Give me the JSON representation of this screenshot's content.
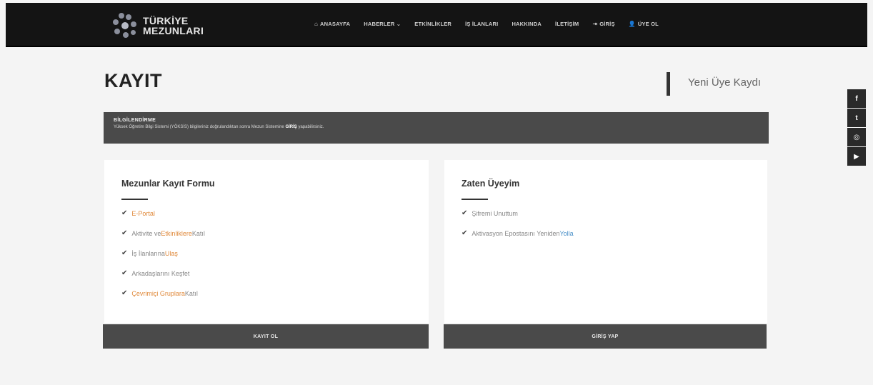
{
  "brand": {
    "line1": "TÜRKİYE",
    "line2": "MEZUNLARI"
  },
  "nav": {
    "items": [
      {
        "icon": "home-icon",
        "glyph": "⌂",
        "label": "ANASAYFA"
      },
      {
        "icon": "",
        "glyph": "",
        "label": "HABERLER ⌄"
      },
      {
        "icon": "",
        "glyph": "",
        "label": "ETKİNLİKLER"
      },
      {
        "icon": "",
        "glyph": "",
        "label": "İŞ İLANLARI"
      },
      {
        "icon": "",
        "glyph": "",
        "label": "HAKKINDA"
      },
      {
        "icon": "",
        "glyph": "",
        "label": "İLETİŞİM"
      },
      {
        "icon": "login-icon",
        "glyph": "⇥",
        "label": "GİRİŞ"
      },
      {
        "icon": "user-icon",
        "glyph": "👤",
        "label": "ÜYE OL"
      }
    ]
  },
  "page": {
    "title": "KAYIT",
    "subtitle": "Yeni Üye Kaydı"
  },
  "info": {
    "title": "BİLGİLENDİRME",
    "text_before": "Yüksek Öğretim Bilgi Sistemi (YÖKSİS) bilgileriniz doğrulandıktan sonra Mezun Sistemine ",
    "text_bold": "GİRİŞ",
    "text_after": " yapabilirsiniz."
  },
  "register_card": {
    "title": "Mezunlar Kayıt Formu",
    "items": [
      {
        "pre": "",
        "hl": "E-Portal",
        "post": ""
      },
      {
        "pre": "Aktivite ve ",
        "hl": "Etkinliklere",
        "post": " Katıl"
      },
      {
        "pre": "İş İlanlarına ",
        "hl": "Ulaş",
        "post": ""
      },
      {
        "pre": "Arkadaşlarını Keşfet",
        "hl": "",
        "post": ""
      },
      {
        "pre": "",
        "hl": "Çevrimiçi Gruplara",
        "post": " Katıl"
      }
    ],
    "button_label": "KAYIT OL"
  },
  "member_card": {
    "title": "Zaten Üyeyim",
    "items": [
      {
        "pre": "Şifremi Unuttum",
        "hl": "",
        "post": ""
      },
      {
        "pre": "Aktivasyon Epostasını Yeniden ",
        "hl": "Yolla",
        "post": ""
      }
    ],
    "button_label": "GİRİŞ YAP"
  },
  "social": [
    {
      "icon": "facebook-icon",
      "glyph": "f"
    },
    {
      "icon": "twitter-icon",
      "glyph": "t"
    },
    {
      "icon": "instagram-icon",
      "glyph": "◎"
    },
    {
      "icon": "youtube-icon",
      "glyph": "▶"
    }
  ],
  "colors": {
    "navbar": "#141414",
    "info_bar": "#4a4a4a",
    "button": "#4a4a4a",
    "accent": "#e08a3c"
  }
}
